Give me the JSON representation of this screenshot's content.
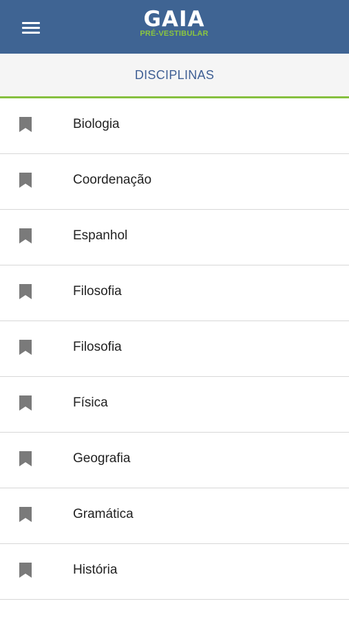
{
  "app": {
    "logo_main": "GAIA",
    "logo_sub": "PRÉ-VESTIBULAR",
    "menu_icon": "hamburger-menu-icon"
  },
  "header": {
    "title": "DISCIPLINAS"
  },
  "colors": {
    "appbar": "#3f6493",
    "accent_green": "#86c03f",
    "title_blue": "#3f5f94",
    "icon_gray": "#7a7a7a"
  },
  "list": {
    "item_icon": "bookmark-icon",
    "items": [
      {
        "label": "Biologia"
      },
      {
        "label": "Coordenação"
      },
      {
        "label": "Espanhol"
      },
      {
        "label": "Filosofia"
      },
      {
        "label": "Filosofia"
      },
      {
        "label": "Física"
      },
      {
        "label": "Geografia"
      },
      {
        "label": "Gramática"
      },
      {
        "label": "História"
      }
    ]
  }
}
